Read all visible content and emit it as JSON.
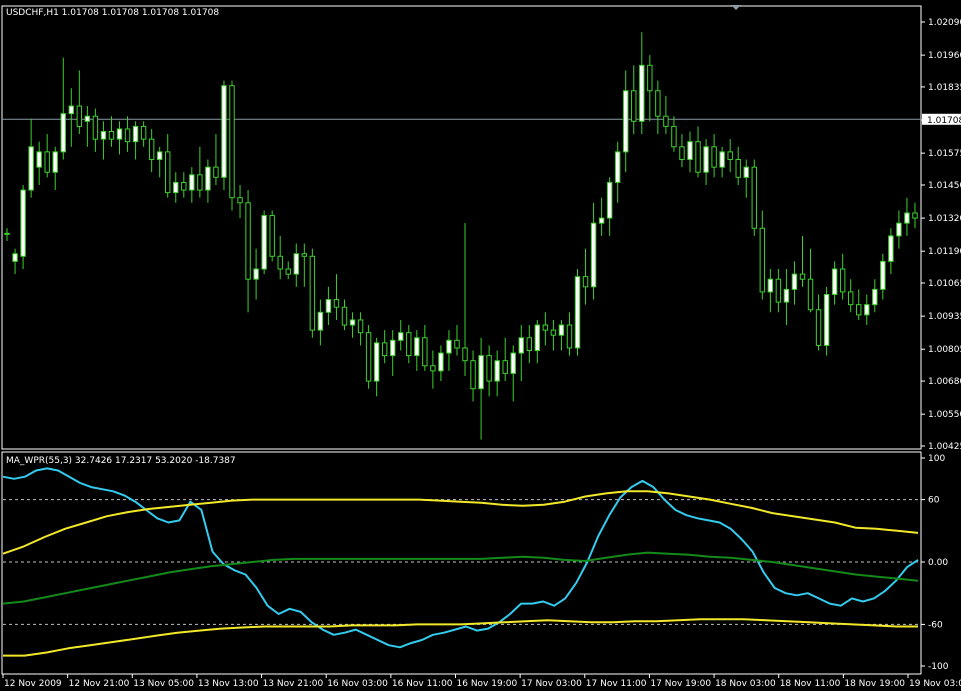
{
  "colors": {
    "background": "#000000",
    "frame": "#ffffff",
    "candle_bull": "#ffffff",
    "candle_wick": "#3cd12a",
    "bid_line": "#8c99a6",
    "wpr_line": "#33ccee",
    "band_line": "#f2e82a",
    "mid_line": "#138a1a",
    "level_line": "#c0c0c0"
  },
  "main_window": {
    "title": "USDCHF,H1  1.01708 1.01708 1.01708 1.01708",
    "bid_price": 1.01708,
    "bid_label": "1.01708"
  },
  "indicator_window": {
    "title": "MA_WPR(55,3) 32.7426 17.2317 53.2020 -18.7387",
    "levels": [
      60,
      0,
      -60
    ],
    "level_labels": [
      "60",
      "0.00",
      "-60"
    ]
  },
  "chart_data": [
    {
      "type": "candlestick",
      "symbol": "USDCHF",
      "timeframe": "H1",
      "ylim": [
        1.00425,
        1.0209
      ],
      "y_tick_labels": [
        "1.02090",
        "1.01960",
        "1.01835",
        "1.01705",
        "1.01575",
        "1.01450",
        "1.01320",
        "1.01190",
        "1.01065",
        "1.00935",
        "1.00805",
        "1.00680",
        "1.00550",
        "1.00425"
      ],
      "y_ticks": [
        1.0209,
        1.0196,
        1.01835,
        1.01705,
        1.01575,
        1.0145,
        1.0132,
        1.0119,
        1.01065,
        1.00935,
        1.00805,
        1.0068,
        1.0055,
        1.00425
      ],
      "ohlc": [
        [
          1.0126,
          1.0128,
          1.0123,
          1.0126
        ],
        [
          1.0115,
          1.012,
          1.011,
          1.0118
        ],
        [
          1.0117,
          1.0145,
          1.0112,
          1.0143
        ],
        [
          1.0143,
          1.0171,
          1.014,
          1.016
        ],
        [
          1.0152,
          1.0162,
          1.0145,
          1.0158
        ],
        [
          1.0158,
          1.0165,
          1.0148,
          1.015
        ],
        [
          1.015,
          1.016,
          1.0143,
          1.0158
        ],
        [
          1.0158,
          1.0195,
          1.0155,
          1.0173
        ],
        [
          1.0173,
          1.0183,
          1.016,
          1.0176
        ],
        [
          1.0176,
          1.019,
          1.0165,
          1.0168
        ],
        [
          1.017,
          1.0176,
          1.016,
          1.0172
        ],
        [
          1.0172,
          1.0175,
          1.0158,
          1.0163
        ],
        [
          1.0163,
          1.017,
          1.0155,
          1.0166
        ],
        [
          1.0166,
          1.0172,
          1.016,
          1.0163
        ],
        [
          1.0163,
          1.017,
          1.0157,
          1.0167
        ],
        [
          1.0167,
          1.0172,
          1.0158,
          1.0162
        ],
        [
          1.0162,
          1.017,
          1.0155,
          1.0168
        ],
        [
          1.0168,
          1.017,
          1.016,
          1.0163
        ],
        [
          1.0163,
          1.0167,
          1.015,
          1.0155
        ],
        [
          1.0155,
          1.016,
          1.0148,
          1.0158
        ],
        [
          1.0158,
          1.0165,
          1.014,
          1.0142
        ],
        [
          1.0142,
          1.015,
          1.0138,
          1.0146
        ],
        [
          1.0146,
          1.015,
          1.014,
          1.0143
        ],
        [
          1.0143,
          1.0152,
          1.0138,
          1.0149
        ],
        [
          1.0149,
          1.016,
          1.014,
          1.0143
        ],
        [
          1.0143,
          1.0155,
          1.0138,
          1.0152
        ],
        [
          1.0152,
          1.0165,
          1.0145,
          1.0148
        ],
        [
          1.0148,
          1.0186,
          1.0143,
          1.0184
        ],
        [
          1.0184,
          1.0186,
          1.0135,
          1.014
        ],
        [
          1.014,
          1.0145,
          1.0132,
          1.0138
        ],
        [
          1.0138,
          1.0143,
          1.0095,
          1.0108
        ],
        [
          1.0108,
          1.012,
          1.01,
          1.0112
        ],
        [
          1.0112,
          1.0135,
          1.011,
          1.0133
        ],
        [
          1.0133,
          1.0135,
          1.0115,
          1.0117
        ],
        [
          1.0117,
          1.0125,
          1.0108,
          1.0112
        ],
        [
          1.0112,
          1.0115,
          1.0108,
          1.011
        ],
        [
          1.011,
          1.0122,
          1.0105,
          1.0118
        ],
        [
          1.0118,
          1.0122,
          1.0105,
          1.0117
        ],
        [
          1.0117,
          1.012,
          1.0085,
          1.0088
        ],
        [
          1.0088,
          1.01,
          1.0082,
          1.0095
        ],
        [
          1.0095,
          1.0105,
          1.009,
          1.01
        ],
        [
          1.01,
          1.011,
          1.0092,
          1.0097
        ],
        [
          1.0097,
          1.01,
          1.0088,
          1.009
        ],
        [
          1.009,
          1.0095,
          1.0085,
          1.0092
        ],
        [
          1.0092,
          1.0095,
          1.0082,
          1.0087
        ],
        [
          1.0087,
          1.009,
          1.0065,
          1.0068
        ],
        [
          1.0068,
          1.0085,
          1.0062,
          1.0083
        ],
        [
          1.0083,
          1.0088,
          1.0075,
          1.0078
        ],
        [
          1.0078,
          1.0088,
          1.007,
          1.0084
        ],
        [
          1.0084,
          1.0092,
          1.008,
          1.0087
        ],
        [
          1.0087,
          1.009,
          1.0075,
          1.0078
        ],
        [
          1.0078,
          1.0088,
          1.0072,
          1.0085
        ],
        [
          1.0085,
          1.009,
          1.0072,
          1.0074
        ],
        [
          1.0074,
          1.008,
          1.0065,
          1.0072
        ],
        [
          1.0072,
          1.0082,
          1.0068,
          1.0079
        ],
        [
          1.0079,
          1.0088,
          1.0072,
          1.0084
        ],
        [
          1.0084,
          1.009,
          1.0078,
          1.0081
        ],
        [
          1.0081,
          1.013,
          1.007,
          1.0076
        ],
        [
          1.0076,
          1.008,
          1.006,
          1.0065
        ],
        [
          1.0065,
          1.0085,
          1.0045,
          1.0078
        ],
        [
          1.0078,
          1.0082,
          1.0062,
          1.0068
        ],
        [
          1.0068,
          1.008,
          1.0062,
          1.0076
        ],
        [
          1.0076,
          1.0085,
          1.0068,
          1.0071
        ],
        [
          1.0071,
          1.0082,
          1.006,
          1.0079
        ],
        [
          1.0079,
          1.009,
          1.0068,
          1.0085
        ],
        [
          1.0085,
          1.009,
          1.0075,
          1.008
        ],
        [
          1.008,
          1.0092,
          1.0075,
          1.009
        ],
        [
          1.009,
          1.0095,
          1.0082,
          1.0088
        ],
        [
          1.0088,
          1.0092,
          1.008,
          1.0086
        ],
        [
          1.0086,
          1.0092,
          1.008,
          1.009
        ],
        [
          1.009,
          1.0095,
          1.0078,
          1.0081
        ],
        [
          1.0081,
          1.0112,
          1.0078,
          1.0109
        ],
        [
          1.0109,
          1.012,
          1.0098,
          1.0105
        ],
        [
          1.0105,
          1.0138,
          1.01,
          1.013
        ],
        [
          1.013,
          1.014,
          1.0125,
          1.0132
        ],
        [
          1.0132,
          1.0148,
          1.0125,
          1.0146
        ],
        [
          1.0146,
          1.0162,
          1.0138,
          1.0158
        ],
        [
          1.0158,
          1.019,
          1.015,
          1.0182
        ],
        [
          1.0182,
          1.0192,
          1.0165,
          1.017
        ],
        [
          1.017,
          1.0205,
          1.0165,
          1.0192
        ],
        [
          1.0192,
          1.0196,
          1.017,
          1.0182
        ],
        [
          1.0182,
          1.0186,
          1.0165,
          1.0172
        ],
        [
          1.0172,
          1.018,
          1.0165,
          1.0168
        ],
        [
          1.0168,
          1.0172,
          1.0158,
          1.016
        ],
        [
          1.016,
          1.0165,
          1.0152,
          1.0155
        ],
        [
          1.0155,
          1.0166,
          1.015,
          1.0162
        ],
        [
          1.0162,
          1.0168,
          1.0148,
          1.015
        ],
        [
          1.015,
          1.0163,
          1.0145,
          1.016
        ],
        [
          1.016,
          1.0165,
          1.0148,
          1.0152
        ],
        [
          1.0152,
          1.016,
          1.0148,
          1.0158
        ],
        [
          1.0158,
          1.0163,
          1.015,
          1.0155
        ],
        [
          1.0155,
          1.016,
          1.0145,
          1.0148
        ],
        [
          1.0148,
          1.0155,
          1.014,
          1.0152
        ],
        [
          1.0152,
          1.0155,
          1.0125,
          1.0128
        ],
        [
          1.0128,
          1.0135,
          1.01,
          1.0103
        ],
        [
          1.0103,
          1.0112,
          1.0095,
          1.0108
        ],
        [
          1.0108,
          1.0112,
          1.0095,
          1.0099
        ],
        [
          1.0099,
          1.0112,
          1.009,
          1.0104
        ],
        [
          1.0104,
          1.0115,
          1.0098,
          1.011
        ],
        [
          1.011,
          1.0125,
          1.0105,
          1.0108
        ],
        [
          1.0108,
          1.012,
          1.0095,
          1.0096
        ],
        [
          1.0096,
          1.0102,
          1.008,
          1.0082
        ],
        [
          1.0082,
          1.0105,
          1.0078,
          1.0102
        ],
        [
          1.0102,
          1.0115,
          1.0098,
          1.0112
        ],
        [
          1.0112,
          1.0118,
          1.01,
          1.0103
        ],
        [
          1.0103,
          1.0108,
          1.0095,
          1.0098
        ],
        [
          1.0098,
          1.0104,
          1.0092,
          1.0094
        ],
        [
          1.0094,
          1.0102,
          1.009,
          1.0098
        ],
        [
          1.0098,
          1.0108,
          1.0095,
          1.0104
        ],
        [
          1.0104,
          1.0118,
          1.01,
          1.0115
        ],
        [
          1.0115,
          1.0128,
          1.011,
          1.0125
        ],
        [
          1.0125,
          1.0135,
          1.012,
          1.013
        ],
        [
          1.013,
          1.014,
          1.0125,
          1.0134
        ],
        [
          1.0134,
          1.0138,
          1.0128,
          1.0132
        ]
      ]
    },
    {
      "type": "line",
      "title": "MA_WPR(55,3) 32.7426 17.2317 53.2020 -18.7387",
      "ylim": [
        -100,
        100
      ],
      "y_tick_labels": [
        "100",
        "60",
        "0.00",
        "-60",
        "-100"
      ],
      "y_ticks": [
        100,
        60,
        0,
        -60,
        -100
      ],
      "x_tick_labels": [
        "12 Nov 2009",
        "12 Nov 21:00",
        "13 Nov 05:00",
        "13 Nov 13:00",
        "13 Nov 21:00",
        "16 Nov 03:00",
        "16 Nov 11:00",
        "16 Nov 19:00",
        "17 Nov 03:00",
        "17 Nov 11:00",
        "17 Nov 19:00",
        "18 Nov 03:00",
        "18 Nov 11:00",
        "18 Nov 19:00",
        "19 Nov 03:00"
      ],
      "series": [
        {
          "color": "#33ccee",
          "values": [
            82,
            80,
            82,
            88,
            90,
            88,
            82,
            76,
            72,
            70,
            68,
            64,
            58,
            50,
            42,
            38,
            40,
            58,
            50,
            10,
            -2,
            -8,
            -12,
            -25,
            -42,
            -50,
            -45,
            -48,
            -58,
            -65,
            -70,
            -68,
            -65,
            -70,
            -75,
            -80,
            -82,
            -78,
            -75,
            -70,
            -68,
            -65,
            -62,
            -66,
            -64,
            -58,
            -50,
            -40,
            -40,
            -38,
            -42,
            -35,
            -20,
            0,
            25,
            45,
            62,
            72,
            78,
            72,
            60,
            50,
            45,
            42,
            40,
            38,
            32,
            22,
            10,
            -10,
            -25,
            -30,
            -32,
            -30,
            -35,
            -40,
            -42,
            -35,
            -38,
            -35,
            -28,
            -18,
            -5,
            2
          ],
          "x_start": 0,
          "x_end": 1
        },
        {
          "color": "#f2e82a",
          "values": [
            8,
            15,
            24,
            32,
            38,
            44,
            48,
            51,
            53,
            55,
            57,
            59,
            60,
            60,
            60,
            60,
            60,
            60,
            60,
            60,
            60,
            59,
            58,
            57,
            55,
            54,
            55,
            58,
            63,
            66,
            68,
            68,
            66,
            63,
            60,
            56,
            52,
            47,
            44,
            41,
            38,
            33,
            32,
            30,
            28
          ],
          "x_start": 0,
          "x_end": 1
        },
        {
          "color": "#f2e82a",
          "values": [
            -90,
            -90,
            -87,
            -83,
            -80,
            -77,
            -74,
            -71,
            -68,
            -66,
            -64,
            -63,
            -62,
            -62,
            -62,
            -62,
            -61,
            -61,
            -61,
            -60,
            -60,
            -60,
            -59,
            -58,
            -57,
            -56,
            -57,
            -58,
            -58,
            -57,
            -57,
            -56,
            -55,
            -55,
            -55,
            -56,
            -57,
            -58,
            -59,
            -60,
            -61,
            -62,
            -62
          ],
          "x_start": 0,
          "x_end": 1
        },
        {
          "color": "#138a1a",
          "values": [
            -40,
            -38,
            -34,
            -30,
            -26,
            -22,
            -18,
            -14,
            -10,
            -7,
            -4,
            -2,
            0,
            2,
            3,
            3,
            3,
            3,
            3,
            3,
            3,
            3,
            3,
            3,
            4,
            5,
            4,
            2,
            1,
            4,
            7,
            9,
            8,
            7,
            5,
            4,
            2,
            0,
            -3,
            -6,
            -9,
            -12,
            -14,
            -16,
            -18
          ],
          "x_start": 0,
          "x_end": 1
        }
      ]
    }
  ]
}
